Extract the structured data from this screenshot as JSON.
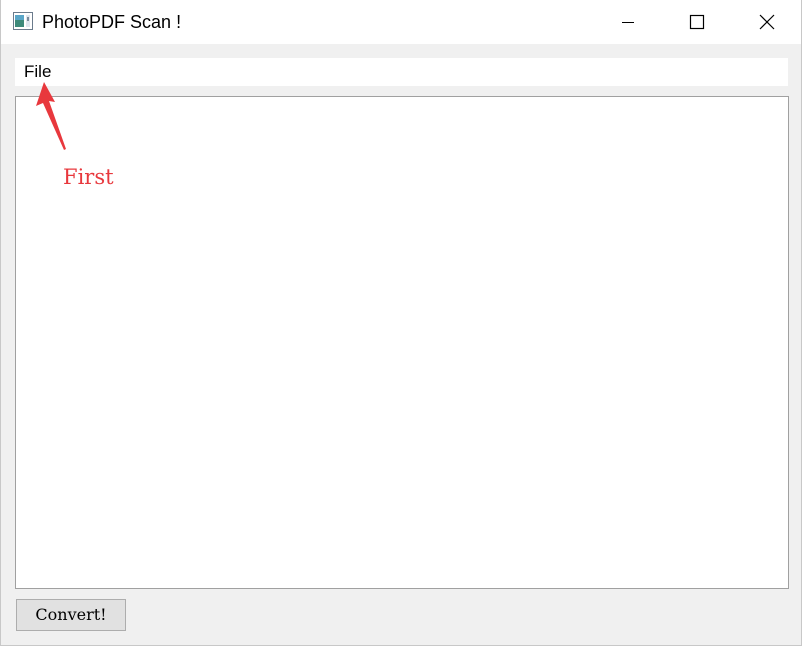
{
  "window": {
    "title": "PhotoPDF Scan !",
    "controls": {
      "minimize_icon": "minimize-icon",
      "maximize_icon": "maximize-icon",
      "close_icon": "close-icon"
    }
  },
  "menubar": {
    "items": [
      {
        "label": "File"
      }
    ]
  },
  "annotation": {
    "text": "First",
    "color": "#e8383d"
  },
  "actions": {
    "convert_label": "Convert!"
  }
}
